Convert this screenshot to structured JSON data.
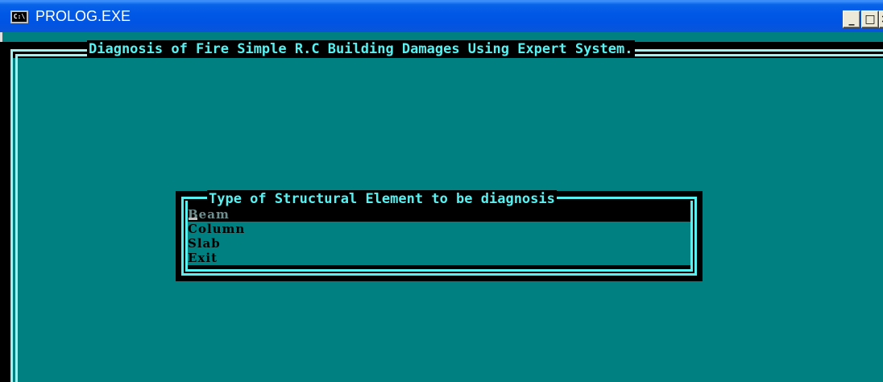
{
  "window": {
    "title": "PROLOG.EXE",
    "icon": "console-icon",
    "icon_text": "C:\\",
    "minimize_label": "_",
    "maximize_label": "□",
    "close_label": "×"
  },
  "console": {
    "header_title": "Diagnosis of Fire Simple R.C Building Damages Using Expert System.",
    "menu": {
      "title": "Type of Structural Element to be diagnosis",
      "items": [
        {
          "label": "Beam",
          "selected": true
        },
        {
          "label": "Column",
          "selected": false
        },
        {
          "label": "Slab",
          "selected": false
        },
        {
          "label": "Exit",
          "selected": false
        }
      ]
    }
  },
  "colors": {
    "console_bg": "#008080",
    "text_highlight": "#58f0f0",
    "titlebar_blue": "#0054e3"
  }
}
